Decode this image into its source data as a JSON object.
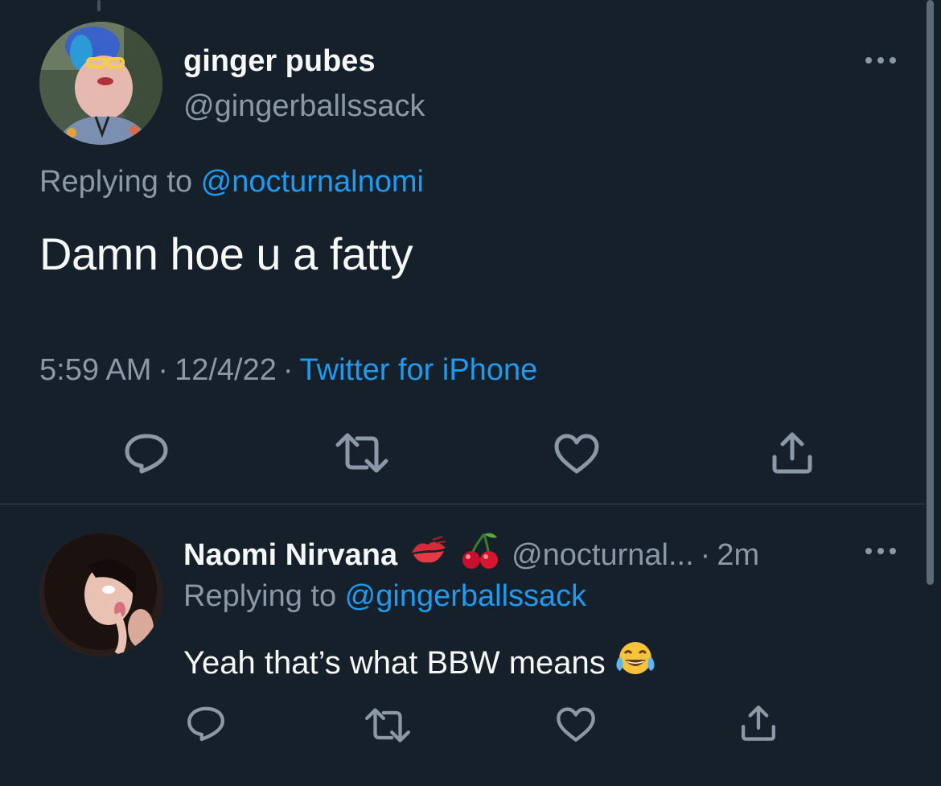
{
  "main_tweet": {
    "author_name": "ginger pubes",
    "author_handle": "@gingerballssack",
    "replying_prefix": "Replying to ",
    "replying_to": "@nocturnalnomi",
    "text": "Damn hoe u a fatty",
    "time": "5:59 AM",
    "date": "12/4/22",
    "source": "Twitter for iPhone",
    "separator": "·",
    "more_icon": "more-dots-icon",
    "actions": [
      "reply-icon",
      "retweet-icon",
      "like-icon",
      "share-icon"
    ]
  },
  "reply_tweet": {
    "author_name": "Naomi Nirvana",
    "author_emojis": [
      "kiss-mark-icon",
      "cherries-icon"
    ],
    "author_handle": "@nocturnal...",
    "separator": "·",
    "time_ago": "2m",
    "replying_prefix": "Replying to ",
    "replying_to": "@gingerballssack",
    "text": "Yeah that’s what BBW means",
    "text_emoji": "tears-of-joy-icon",
    "more_icon": "more-dots-icon",
    "actions": [
      "reply-icon",
      "retweet-icon",
      "like-icon",
      "share-icon"
    ]
  },
  "colors": {
    "background": "#15202b",
    "primary_text": "#f7f9f9",
    "secondary_text": "#8b98a5",
    "link": "#1d9bf0",
    "divider": "#38444d"
  }
}
